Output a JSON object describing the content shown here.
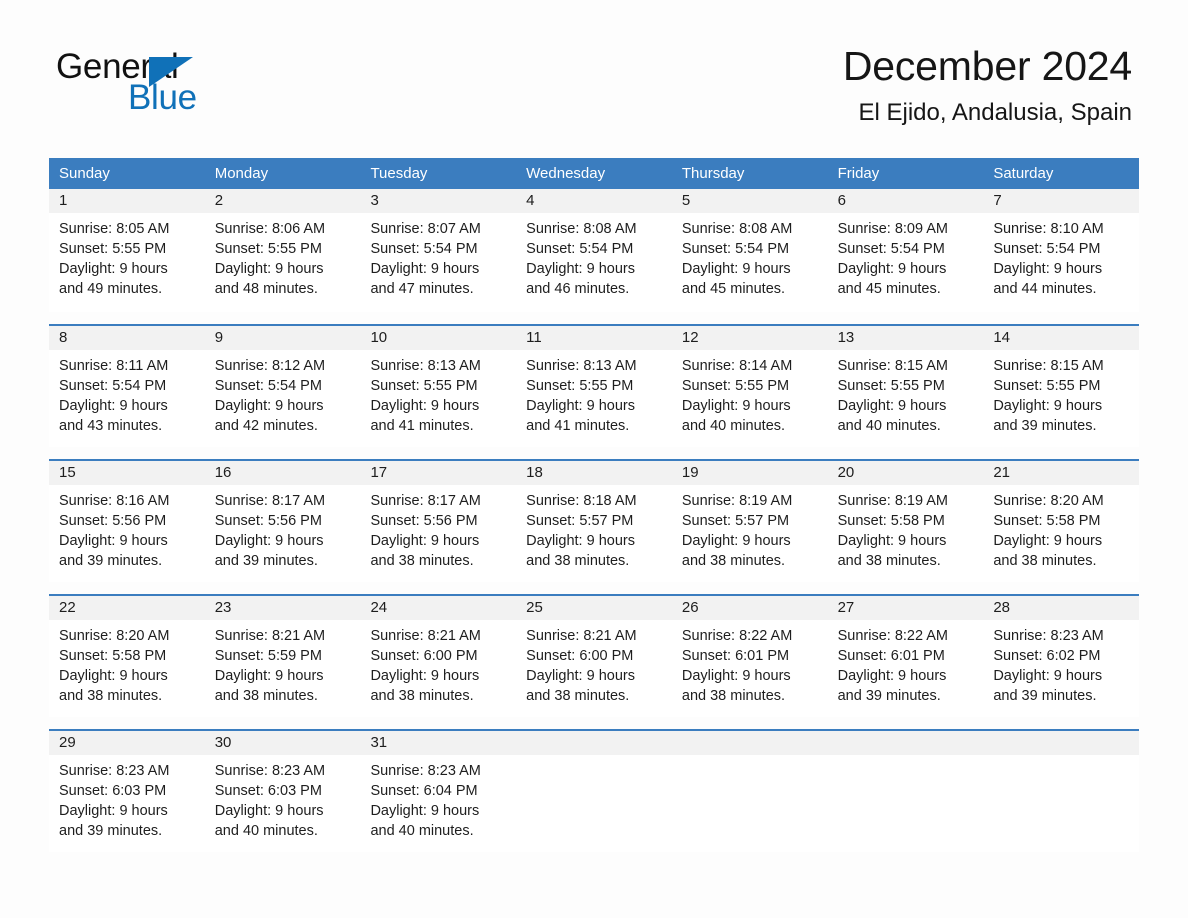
{
  "brand": {
    "name_part1": "General",
    "name_part2": "Blue",
    "triangle_icon": "triangle-icon",
    "accent_color": "#1071b8"
  },
  "header": {
    "month_title": "December 2024",
    "location": "El Ejido, Andalusia, Spain"
  },
  "theme": {
    "header_blue": "#3b7dbf",
    "day_number_band": "#f2f2f2",
    "page_background": "#fdfdfd"
  },
  "weekdays": [
    "Sunday",
    "Monday",
    "Tuesday",
    "Wednesday",
    "Thursday",
    "Friday",
    "Saturday"
  ],
  "weeks": [
    [
      {
        "day": "1",
        "sunrise": "Sunrise: 8:05 AM",
        "sunset": "Sunset: 5:55 PM",
        "daylight_1": "Daylight: 9 hours",
        "daylight_2": "and 49 minutes."
      },
      {
        "day": "2",
        "sunrise": "Sunrise: 8:06 AM",
        "sunset": "Sunset: 5:55 PM",
        "daylight_1": "Daylight: 9 hours",
        "daylight_2": "and 48 minutes."
      },
      {
        "day": "3",
        "sunrise": "Sunrise: 8:07 AM",
        "sunset": "Sunset: 5:54 PM",
        "daylight_1": "Daylight: 9 hours",
        "daylight_2": "and 47 minutes."
      },
      {
        "day": "4",
        "sunrise": "Sunrise: 8:08 AM",
        "sunset": "Sunset: 5:54 PM",
        "daylight_1": "Daylight: 9 hours",
        "daylight_2": "and 46 minutes."
      },
      {
        "day": "5",
        "sunrise": "Sunrise: 8:08 AM",
        "sunset": "Sunset: 5:54 PM",
        "daylight_1": "Daylight: 9 hours",
        "daylight_2": "and 45 minutes."
      },
      {
        "day": "6",
        "sunrise": "Sunrise: 8:09 AM",
        "sunset": "Sunset: 5:54 PM",
        "daylight_1": "Daylight: 9 hours",
        "daylight_2": "and 45 minutes."
      },
      {
        "day": "7",
        "sunrise": "Sunrise: 8:10 AM",
        "sunset": "Sunset: 5:54 PM",
        "daylight_1": "Daylight: 9 hours",
        "daylight_2": "and 44 minutes."
      }
    ],
    [
      {
        "day": "8",
        "sunrise": "Sunrise: 8:11 AM",
        "sunset": "Sunset: 5:54 PM",
        "daylight_1": "Daylight: 9 hours",
        "daylight_2": "and 43 minutes."
      },
      {
        "day": "9",
        "sunrise": "Sunrise: 8:12 AM",
        "sunset": "Sunset: 5:54 PM",
        "daylight_1": "Daylight: 9 hours",
        "daylight_2": "and 42 minutes."
      },
      {
        "day": "10",
        "sunrise": "Sunrise: 8:13 AM",
        "sunset": "Sunset: 5:55 PM",
        "daylight_1": "Daylight: 9 hours",
        "daylight_2": "and 41 minutes."
      },
      {
        "day": "11",
        "sunrise": "Sunrise: 8:13 AM",
        "sunset": "Sunset: 5:55 PM",
        "daylight_1": "Daylight: 9 hours",
        "daylight_2": "and 41 minutes."
      },
      {
        "day": "12",
        "sunrise": "Sunrise: 8:14 AM",
        "sunset": "Sunset: 5:55 PM",
        "daylight_1": "Daylight: 9 hours",
        "daylight_2": "and 40 minutes."
      },
      {
        "day": "13",
        "sunrise": "Sunrise: 8:15 AM",
        "sunset": "Sunset: 5:55 PM",
        "daylight_1": "Daylight: 9 hours",
        "daylight_2": "and 40 minutes."
      },
      {
        "day": "14",
        "sunrise": "Sunrise: 8:15 AM",
        "sunset": "Sunset: 5:55 PM",
        "daylight_1": "Daylight: 9 hours",
        "daylight_2": "and 39 minutes."
      }
    ],
    [
      {
        "day": "15",
        "sunrise": "Sunrise: 8:16 AM",
        "sunset": "Sunset: 5:56 PM",
        "daylight_1": "Daylight: 9 hours",
        "daylight_2": "and 39 minutes."
      },
      {
        "day": "16",
        "sunrise": "Sunrise: 8:17 AM",
        "sunset": "Sunset: 5:56 PM",
        "daylight_1": "Daylight: 9 hours",
        "daylight_2": "and 39 minutes."
      },
      {
        "day": "17",
        "sunrise": "Sunrise: 8:17 AM",
        "sunset": "Sunset: 5:56 PM",
        "daylight_1": "Daylight: 9 hours",
        "daylight_2": "and 38 minutes."
      },
      {
        "day": "18",
        "sunrise": "Sunrise: 8:18 AM",
        "sunset": "Sunset: 5:57 PM",
        "daylight_1": "Daylight: 9 hours",
        "daylight_2": "and 38 minutes."
      },
      {
        "day": "19",
        "sunrise": "Sunrise: 8:19 AM",
        "sunset": "Sunset: 5:57 PM",
        "daylight_1": "Daylight: 9 hours",
        "daylight_2": "and 38 minutes."
      },
      {
        "day": "20",
        "sunrise": "Sunrise: 8:19 AM",
        "sunset": "Sunset: 5:58 PM",
        "daylight_1": "Daylight: 9 hours",
        "daylight_2": "and 38 minutes."
      },
      {
        "day": "21",
        "sunrise": "Sunrise: 8:20 AM",
        "sunset": "Sunset: 5:58 PM",
        "daylight_1": "Daylight: 9 hours",
        "daylight_2": "and 38 minutes."
      }
    ],
    [
      {
        "day": "22",
        "sunrise": "Sunrise: 8:20 AM",
        "sunset": "Sunset: 5:58 PM",
        "daylight_1": "Daylight: 9 hours",
        "daylight_2": "and 38 minutes."
      },
      {
        "day": "23",
        "sunrise": "Sunrise: 8:21 AM",
        "sunset": "Sunset: 5:59 PM",
        "daylight_1": "Daylight: 9 hours",
        "daylight_2": "and 38 minutes."
      },
      {
        "day": "24",
        "sunrise": "Sunrise: 8:21 AM",
        "sunset": "Sunset: 6:00 PM",
        "daylight_1": "Daylight: 9 hours",
        "daylight_2": "and 38 minutes."
      },
      {
        "day": "25",
        "sunrise": "Sunrise: 8:21 AM",
        "sunset": "Sunset: 6:00 PM",
        "daylight_1": "Daylight: 9 hours",
        "daylight_2": "and 38 minutes."
      },
      {
        "day": "26",
        "sunrise": "Sunrise: 8:22 AM",
        "sunset": "Sunset: 6:01 PM",
        "daylight_1": "Daylight: 9 hours",
        "daylight_2": "and 38 minutes."
      },
      {
        "day": "27",
        "sunrise": "Sunrise: 8:22 AM",
        "sunset": "Sunset: 6:01 PM",
        "daylight_1": "Daylight: 9 hours",
        "daylight_2": "and 39 minutes."
      },
      {
        "day": "28",
        "sunrise": "Sunrise: 8:23 AM",
        "sunset": "Sunset: 6:02 PM",
        "daylight_1": "Daylight: 9 hours",
        "daylight_2": "and 39 minutes."
      }
    ],
    [
      {
        "day": "29",
        "sunrise": "Sunrise: 8:23 AM",
        "sunset": "Sunset: 6:03 PM",
        "daylight_1": "Daylight: 9 hours",
        "daylight_2": "and 39 minutes."
      },
      {
        "day": "30",
        "sunrise": "Sunrise: 8:23 AM",
        "sunset": "Sunset: 6:03 PM",
        "daylight_1": "Daylight: 9 hours",
        "daylight_2": "and 40 minutes."
      },
      {
        "day": "31",
        "sunrise": "Sunrise: 8:23 AM",
        "sunset": "Sunset: 6:04 PM",
        "daylight_1": "Daylight: 9 hours",
        "daylight_2": "and 40 minutes."
      },
      {
        "day": "",
        "sunrise": "",
        "sunset": "",
        "daylight_1": "",
        "daylight_2": ""
      },
      {
        "day": "",
        "sunrise": "",
        "sunset": "",
        "daylight_1": "",
        "daylight_2": ""
      },
      {
        "day": "",
        "sunrise": "",
        "sunset": "",
        "daylight_1": "",
        "daylight_2": ""
      },
      {
        "day": "",
        "sunrise": "",
        "sunset": "",
        "daylight_1": "",
        "daylight_2": ""
      }
    ]
  ]
}
